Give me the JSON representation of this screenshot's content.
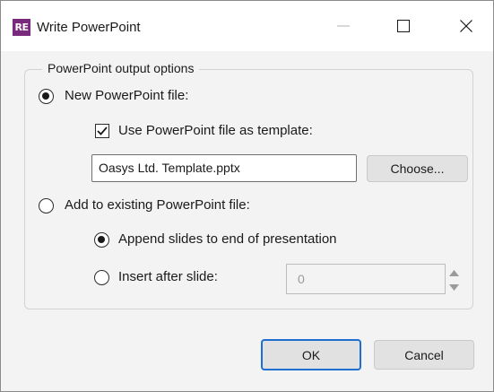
{
  "window": {
    "title": "Write PowerPoint",
    "logo_text": "RE",
    "logo_color": "#7a2a7c"
  },
  "group": {
    "legend": "PowerPoint output options"
  },
  "options": {
    "new_file": {
      "label": "New PowerPoint file:",
      "selected": true
    },
    "use_template": {
      "label": "Use PowerPoint file as template:",
      "checked": true
    },
    "template_path": {
      "value": "Oasys Ltd. Template.pptx"
    },
    "choose_button": "Choose...",
    "add_existing": {
      "label": "Add to existing PowerPoint file:",
      "selected": false
    },
    "append_slides": {
      "label": "Append slides to end of presentation",
      "selected": true
    },
    "insert_after": {
      "label": "Insert after slide:",
      "selected": false
    },
    "insert_after_value": "0"
  },
  "buttons": {
    "ok": "OK",
    "cancel": "Cancel",
    "accent_color": "#1f6fd0"
  },
  "icons": {
    "minimize": "minimize-icon",
    "maximize": "maximize-icon",
    "close": "close-icon",
    "check": "checkmark-icon",
    "spin_up": "triangle-up-icon",
    "spin_down": "triangle-down-icon"
  }
}
